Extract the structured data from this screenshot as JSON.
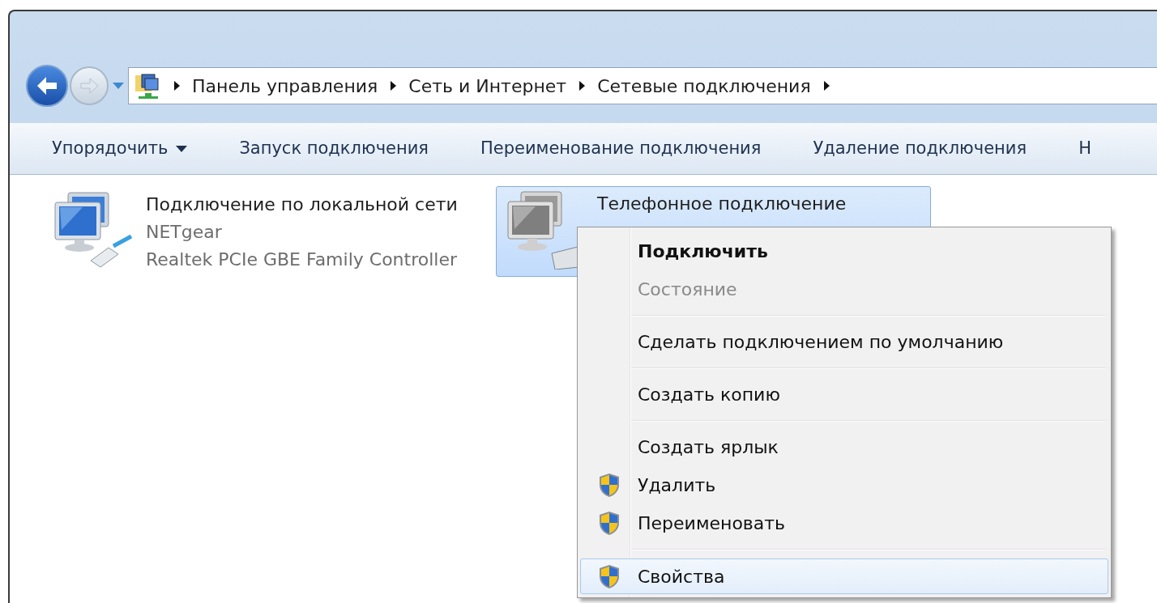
{
  "breadcrumb": [
    "Панель управления",
    "Сеть и Интернет",
    "Сетевые подключения"
  ],
  "toolbar": [
    {
      "label": "Упорядочить",
      "dropdown": true
    },
    {
      "label": "Запуск подключения",
      "dropdown": false
    },
    {
      "label": "Переименование подключения",
      "dropdown": false
    },
    {
      "label": "Удаление подключения",
      "dropdown": false
    },
    {
      "label": "Н",
      "dropdown": false
    }
  ],
  "connections": [
    {
      "kind": "lan",
      "name": "Подключение по локальной сети",
      "lines": [
        "NETgear",
        "Realtek PCIe GBE Family Controller"
      ],
      "selected": false
    },
    {
      "kind": "dialup",
      "name": "Телефонное подключение",
      "selected": true
    }
  ],
  "context_menu": [
    {
      "kind": "item",
      "label": "Подключить",
      "bold": true,
      "disabled": false,
      "shield": false,
      "selected": false
    },
    {
      "kind": "item",
      "label": "Состояние",
      "bold": false,
      "disabled": true,
      "shield": false,
      "selected": false
    },
    {
      "kind": "separator"
    },
    {
      "kind": "item",
      "label": "Сделать подключением по умолчанию",
      "bold": false,
      "disabled": false,
      "shield": false,
      "selected": false
    },
    {
      "kind": "separator"
    },
    {
      "kind": "item",
      "label": "Создать копию",
      "bold": false,
      "disabled": false,
      "shield": false,
      "selected": false
    },
    {
      "kind": "separator"
    },
    {
      "kind": "item",
      "label": "Создать ярлык",
      "bold": false,
      "disabled": false,
      "shield": false,
      "selected": false
    },
    {
      "kind": "item",
      "label": "Удалить",
      "bold": false,
      "disabled": false,
      "shield": true,
      "selected": false
    },
    {
      "kind": "item",
      "label": "Переименовать",
      "bold": false,
      "disabled": false,
      "shield": true,
      "selected": false
    },
    {
      "kind": "separator"
    },
    {
      "kind": "item",
      "label": "Свойства",
      "bold": false,
      "disabled": false,
      "shield": true,
      "selected": true
    }
  ]
}
